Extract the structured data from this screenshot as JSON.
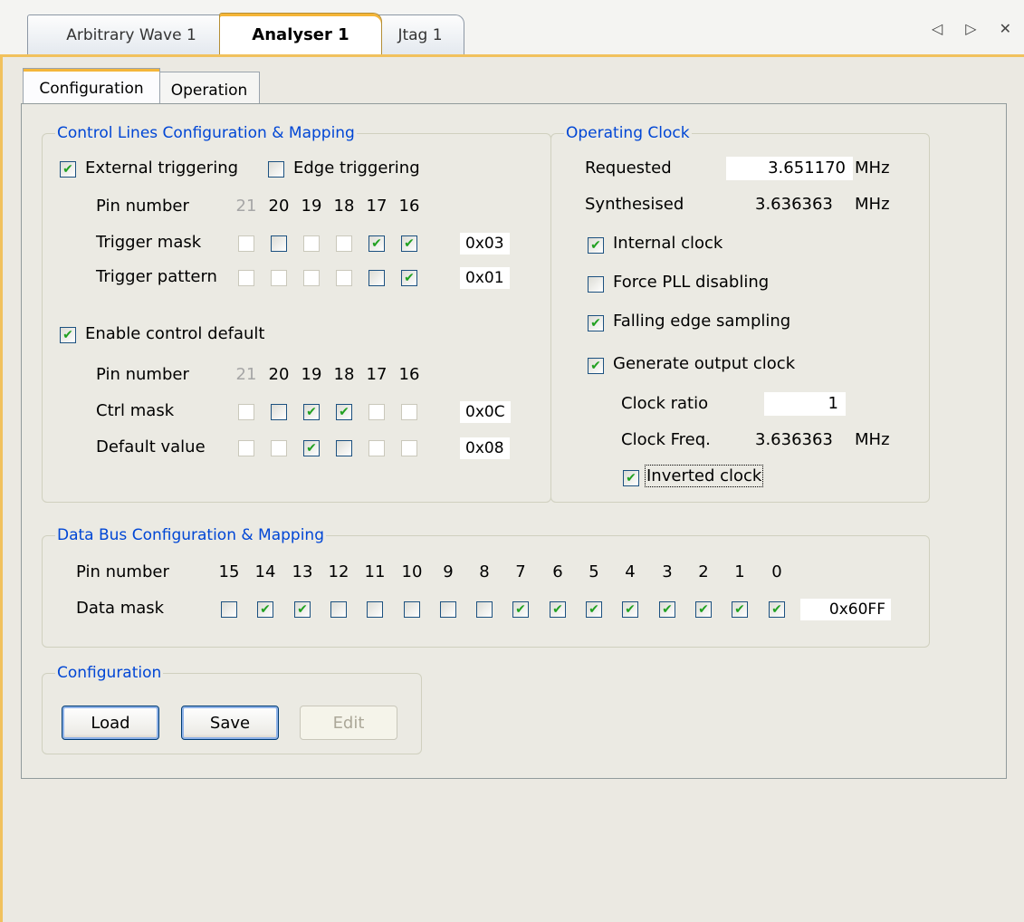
{
  "doc_tabs": [
    {
      "label": "Arbitrary Wave 1"
    },
    {
      "label": "Analyser 1"
    },
    {
      "label": "Jtag 1"
    }
  ],
  "nav_icons": {
    "left": "left-arrow-icon",
    "right": "right-arrow-icon",
    "close": "close-icon"
  },
  "nav_symbols": "◁ ▷ ✕",
  "inner_tabs": [
    {
      "label": "Configuration"
    },
    {
      "label": "Operation"
    }
  ],
  "control_lines": {
    "title": "Control Lines Configuration & Mapping",
    "external_triggering": {
      "label": "External triggering",
      "checked": true
    },
    "edge_triggering": {
      "label": "Edge triggering",
      "checked": false
    },
    "pin_number_label": "Pin number",
    "pins": [
      "21",
      "20",
      "19",
      "18",
      "17",
      "16"
    ],
    "trigger_mask": {
      "label": "Trigger mask",
      "bits": [
        false,
        false,
        false,
        false,
        true,
        true
      ],
      "enabled": [
        false,
        true,
        false,
        false,
        true,
        true
      ],
      "hex": "0x03"
    },
    "trigger_pattern": {
      "label": "Trigger pattern",
      "bits": [
        false,
        false,
        false,
        false,
        false,
        true
      ],
      "enabled": [
        false,
        false,
        false,
        false,
        true,
        true
      ],
      "hex": "0x01"
    },
    "enable_control_default": {
      "label": "Enable control default",
      "checked": true
    },
    "ctrl_mask": {
      "label": "Ctrl mask",
      "bits": [
        false,
        false,
        true,
        true,
        false,
        false
      ],
      "enabled": [
        false,
        true,
        true,
        true,
        false,
        false
      ],
      "hex": "0x0C"
    },
    "default_value": {
      "label": "Default value",
      "bits": [
        false,
        false,
        true,
        false,
        false,
        false
      ],
      "enabled": [
        false,
        false,
        true,
        true,
        false,
        false
      ],
      "hex": "0x08"
    }
  },
  "operating_clock": {
    "title": "Operating Clock",
    "requested_label": "Requested",
    "requested_value": "3.651170",
    "requested_unit": "MHz",
    "synthesised_label": "Synthesised",
    "synthesised_value": "3.636363",
    "synthesised_unit": "MHz",
    "internal_clock": {
      "label": "Internal clock",
      "checked": true
    },
    "force_pll": {
      "label": "Force PLL disabling",
      "checked": false
    },
    "falling_edge": {
      "label": "Falling edge sampling",
      "checked": true
    },
    "generate_output": {
      "label": "Generate output clock",
      "checked": true
    },
    "clock_ratio_label": "Clock ratio",
    "clock_ratio_value": "1",
    "clock_freq_label": "Clock Freq.",
    "clock_freq_value": "3.636363",
    "clock_freq_unit": "MHz",
    "inverted_clock": {
      "label": "Inverted clock",
      "checked": true
    }
  },
  "data_bus": {
    "title": "Data Bus Configuration & Mapping",
    "pin_number_label": "Pin number",
    "pins": [
      "15",
      "14",
      "13",
      "12",
      "11",
      "10",
      "9",
      "8",
      "7",
      "6",
      "5",
      "4",
      "3",
      "2",
      "1",
      "0"
    ],
    "data_mask_label": "Data mask",
    "bits": [
      false,
      true,
      true,
      false,
      false,
      false,
      false,
      false,
      true,
      true,
      true,
      true,
      true,
      true,
      true,
      true
    ],
    "hex": "0x60FF"
  },
  "configuration": {
    "title": "Configuration",
    "load_label": "Load",
    "save_label": "Save",
    "edit_label": "Edit"
  },
  "colors": {
    "accent": "#f5b537",
    "group_title": "#0046d5",
    "check": "#21a121"
  }
}
